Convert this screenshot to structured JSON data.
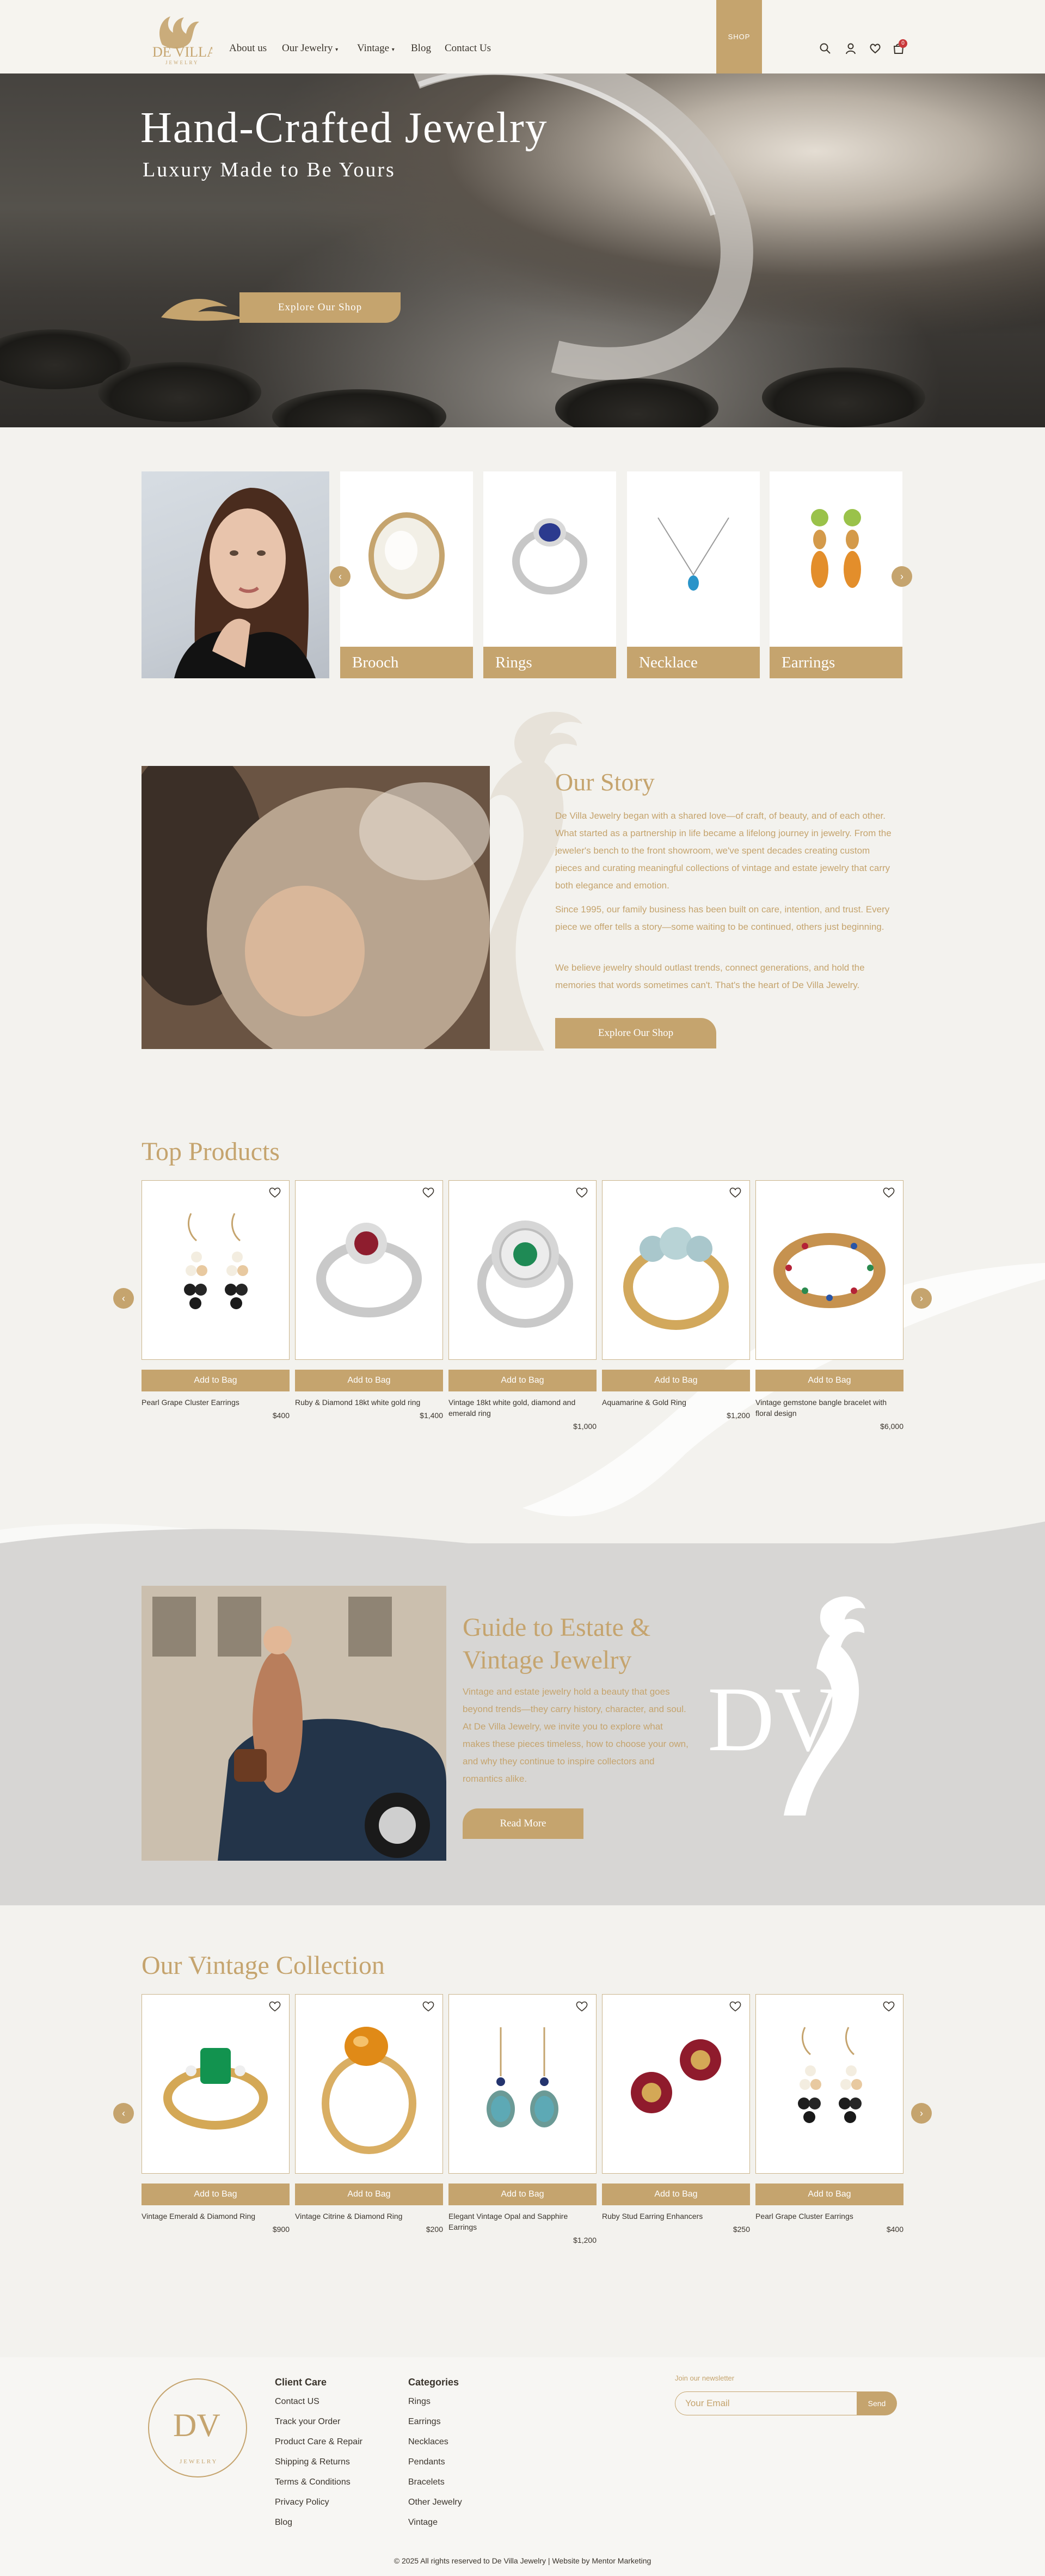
{
  "brand": {
    "logo_main": "DE VILLA",
    "logo_sub": "JEWELRY"
  },
  "nav": {
    "links": [
      "About us",
      "Our Jewelry",
      "Vintage",
      "Blog",
      "Contact Us"
    ],
    "shop_label": "SHOP",
    "cart_count": "0",
    "icons": [
      "search-icon",
      "user-icon",
      "heart-icon",
      "cart-icon"
    ]
  },
  "hero": {
    "title": "Hand-Crafted Jewelry",
    "subtitle": "Luxury Made to Be Yours",
    "cta": "Explore Our Shop"
  },
  "categories": [
    "Brooch",
    "Rings",
    "Necklace",
    "Earrings"
  ],
  "story": {
    "title": "Our Story",
    "paragraphs": [
      "De Villa Jewelry began with a shared love—of craft, of beauty, and of each other. What started as a partnership in life became a lifelong journey in jewelry. From the jeweler's bench to the front showroom, we've spent decades creating custom pieces and curating meaningful collections of vintage and estate jewelry that carry both elegance and emotion.",
      "Since 1995, our family business has been built on care, intention, and trust. Every piece we offer tells a story—some waiting to be continued, others just beginning.",
      "We believe jewelry should outlast trends, connect generations, and hold the memories that words sometimes can't. That's the heart of De Villa Jewelry."
    ],
    "cta": "Explore Our Shop"
  },
  "top_products": {
    "title": "Top Products",
    "add_label": "Add to Bag",
    "items": [
      {
        "name": "Pearl Grape Cluster Earrings",
        "price": "$400"
      },
      {
        "name": "Ruby & Diamond 18kt white gold ring",
        "price": "$1,400"
      },
      {
        "name": "Vintage 18kt white gold, diamond and emerald ring",
        "price": "$1,000"
      },
      {
        "name": "Aquamarine & Gold Ring",
        "price": "$1,200"
      },
      {
        "name": "Vintage gemstone bangle bracelet with floral design",
        "price": "$6,000"
      }
    ]
  },
  "guide": {
    "title": "Guide to Estate & Vintage Jewelry",
    "body": "Vintage and estate jewelry hold a beauty that goes beyond trends—they carry history, character, and soul. At De Villa Jewelry, we invite you to explore what makes these pieces timeless, how to choose your own, and why they continue to inspire collectors and romantics alike.",
    "cta": "Read More",
    "monogram": "DV"
  },
  "vintage": {
    "title": "Our Vintage Collection",
    "add_label": "Add to Bag",
    "items": [
      {
        "name": "Vintage Emerald & Diamond Ring",
        "price": "$900"
      },
      {
        "name": "Vintage Citrine & Diamond Ring",
        "price": "$200"
      },
      {
        "name": "Elegant Vintage Opal and Sapphire Earrings",
        "price": "$1,200"
      },
      {
        "name": "Ruby Stud Earring Enhancers",
        "price": "$250"
      },
      {
        "name": "Pearl Grape Cluster Earrings",
        "price": "$400"
      }
    ]
  },
  "footer": {
    "client_care_title": "Client Care",
    "client_care": [
      "Contact US",
      "Track your Order",
      "Product Care & Repair",
      "Shipping & Returns",
      "Terms & Conditions",
      "Privacy Policy",
      "Blog"
    ],
    "categories_title": "Categories",
    "categories": [
      "Rings",
      "Earrings",
      "Necklaces",
      "Pendants",
      "Bracelets",
      "Other Jewelry",
      "Vintage"
    ],
    "newsletter_label": "Join our newsletter",
    "email_placeholder": "Your Email",
    "send_label": "Send",
    "badge_text": "JEWELRY",
    "copyright": "© 2025 All rights reserved to De Villa Jewelry | Website by Mentor Marketing"
  },
  "colors": {
    "accent": "#c5a46e",
    "background": "#f3f2ee",
    "guide_band": "#d7d6d4",
    "text": "#3a342c"
  }
}
